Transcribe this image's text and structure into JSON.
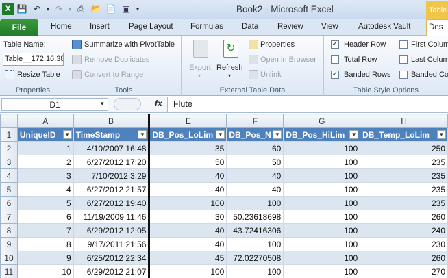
{
  "window": {
    "title": "Book2  -  Microsoft Excel",
    "context_title": "Table"
  },
  "tabs": [
    "File",
    "Home",
    "Insert",
    "Page Layout",
    "Formulas",
    "Data",
    "Review",
    "View",
    "Autodesk Vault",
    "Des"
  ],
  "ribbon": {
    "properties": {
      "table_name_label": "Table Name:",
      "table_name_value": "Table__172.16.38",
      "resize_label": "Resize Table",
      "group_label": "Properties"
    },
    "tools": {
      "summarize": "Summarize with PivotTable",
      "remove_duplicates": "Remove Duplicates",
      "convert": "Convert to Range",
      "group_label": "Tools"
    },
    "external": {
      "export": "Export",
      "refresh": "Refresh",
      "properties": "Properties",
      "open_browser": "Open in Browser",
      "unlink": "Unlink",
      "group_label": "External Table Data"
    },
    "style_options": {
      "header_row": "Header Row",
      "total_row": "Total Row",
      "banded_rows": "Banded Rows",
      "first_column": "First Colum",
      "last_column": "Last Colum",
      "banded_columns": "Banded Co",
      "group_label": "Table Style Options",
      "checked": {
        "header_row": true,
        "total_row": false,
        "banded_rows": true,
        "first_column": false,
        "last_column": false,
        "banded_columns": false
      }
    }
  },
  "formula_bar": {
    "name_box": "D1",
    "fx": "fx",
    "value": "Flute"
  },
  "grid": {
    "columns": [
      "A",
      "B",
      "E",
      "F",
      "G",
      "H"
    ],
    "row_numbers": [
      "1",
      "2",
      "3",
      "4",
      "5",
      "6",
      "7",
      "8",
      "9",
      "10",
      "11"
    ],
    "headers": [
      "UniqueID",
      "TimeStamp",
      "DB_Pos_LoLim",
      "DB_Pos_N",
      "DB_Pos_HiLim",
      "DB_Temp_LoLim"
    ],
    "rows": [
      [
        "1",
        "4/10/2007 16:48",
        "35",
        "60",
        "100",
        "250"
      ],
      [
        "2",
        "6/27/2012 17:20",
        "50",
        "50",
        "100",
        "235"
      ],
      [
        "3",
        "7/10/2012 3:29",
        "40",
        "40",
        "100",
        "235"
      ],
      [
        "4",
        "6/27/2012 21:57",
        "40",
        "40",
        "100",
        "235"
      ],
      [
        "5",
        "6/27/2012 19:40",
        "100",
        "100",
        "100",
        "235"
      ],
      [
        "6",
        "11/19/2009 11:46",
        "30",
        "50.23618698",
        "100",
        "260"
      ],
      [
        "7",
        "6/29/2012 12:05",
        "40",
        "43.72416306",
        "100",
        "240"
      ],
      [
        "8",
        "9/17/2011 21:56",
        "40",
        "100",
        "100",
        "230"
      ],
      [
        "9",
        "6/25/2012 22:34",
        "45",
        "72.02270508",
        "100",
        "260"
      ],
      [
        "10",
        "6/29/2012 21:07",
        "100",
        "100",
        "100",
        "270"
      ]
    ]
  }
}
